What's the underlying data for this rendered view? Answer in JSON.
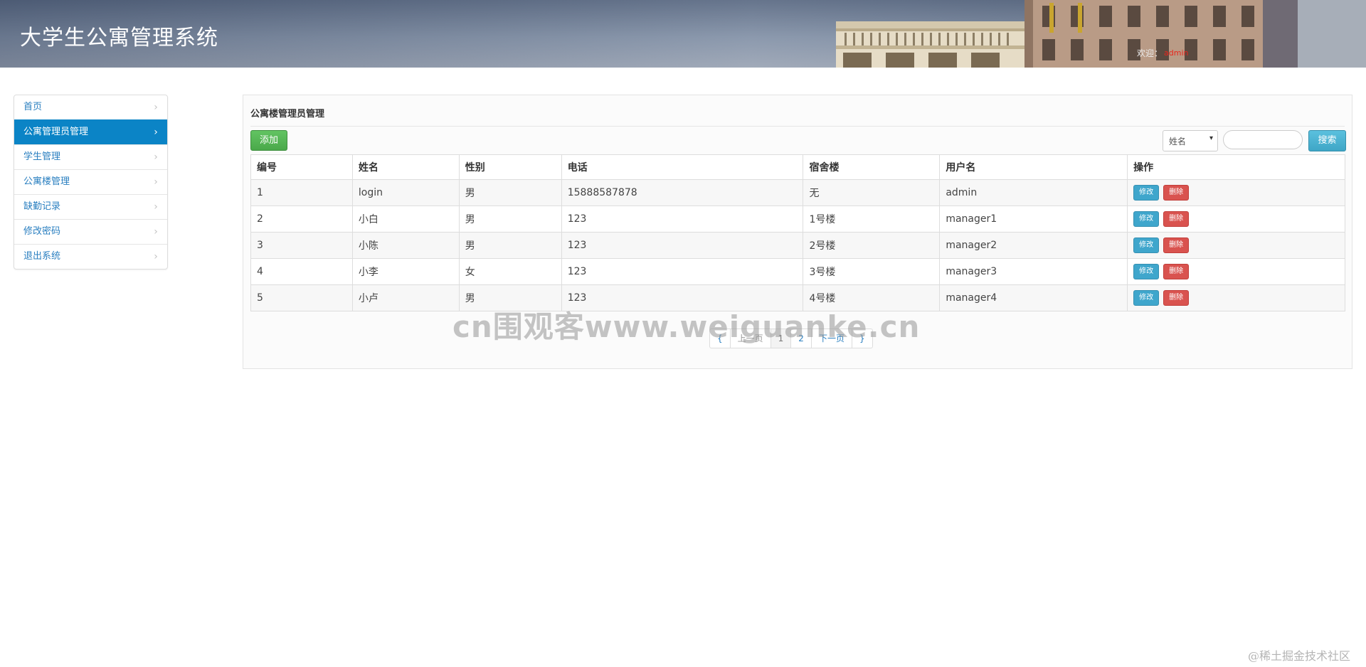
{
  "header": {
    "title": "大学生公寓管理系统",
    "user_label": "欢迎：",
    "user_name": "admin"
  },
  "sidebar": {
    "items": [
      {
        "label": "首页",
        "active": false
      },
      {
        "label": "公寓管理员管理",
        "active": true
      },
      {
        "label": "学生管理",
        "active": false
      },
      {
        "label": "公寓楼管理",
        "active": false
      },
      {
        "label": "缺勤记录",
        "active": false
      },
      {
        "label": "修改密码",
        "active": false
      },
      {
        "label": "退出系统",
        "active": false
      }
    ]
  },
  "main": {
    "title": "公寓楼管理员管理",
    "add_label": "添加",
    "search_field": "姓名",
    "search_value": "",
    "search_label": "搜索",
    "table": {
      "columns": [
        "编号",
        "姓名",
        "性别",
        "电话",
        "宿舍楼",
        "用户名",
        "操作"
      ],
      "rows": [
        [
          "1",
          "login",
          "男",
          "15888587878",
          "无",
          "admin"
        ],
        [
          "2",
          "小白",
          "男",
          "123",
          "1号楼",
          "manager1"
        ],
        [
          "3",
          "小陈",
          "男",
          "123",
          "2号楼",
          "manager2"
        ],
        [
          "4",
          "小李",
          "女",
          "123",
          "3号楼",
          "manager3"
        ],
        [
          "5",
          "小卢",
          "男",
          "123",
          "4号楼",
          "manager4"
        ]
      ],
      "edit_label": "修改",
      "delete_label": "删除"
    },
    "pagination": {
      "first": "{",
      "prev": "上一页",
      "pages": [
        "1",
        "2"
      ],
      "current": "1",
      "next": "下一页",
      "last": "}"
    }
  },
  "watermarks": {
    "center": "cn围观客www.weiguanke.cn",
    "corner": "@稀土掘金技术社区"
  },
  "colors": {
    "sidebar_active": "#0b84c6",
    "link": "#2a7fc0",
    "add_button": "#5cb85c",
    "search_button": "#5bc0de",
    "edit_button": "#3fa6cc",
    "delete_button": "#d9534f"
  }
}
